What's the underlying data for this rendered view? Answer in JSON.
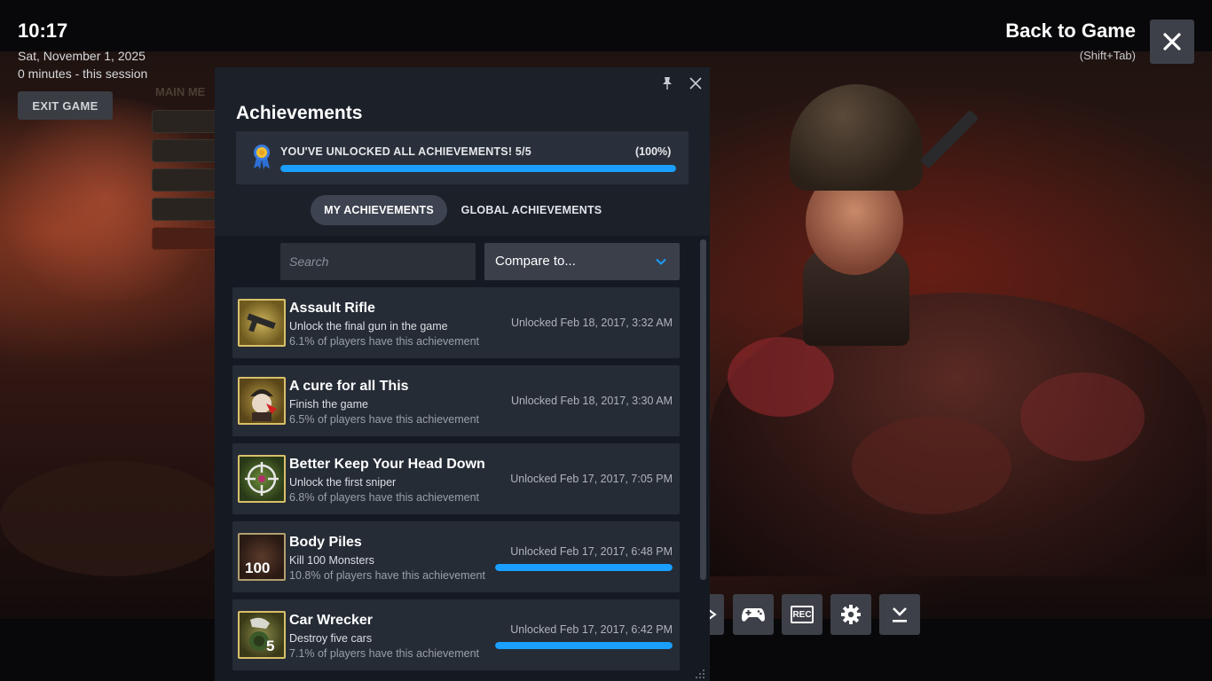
{
  "overlay": {
    "time": "10:17",
    "date": "Sat, November 1, 2025",
    "session": "0 minutes - this session",
    "exit_label": "EXIT GAME",
    "back_label": "Back to Game",
    "back_hotkey": "(Shift+Tab)",
    "close_icon": "close-icon"
  },
  "game_menu": {
    "title": "MAIN ME"
  },
  "toolbar": {
    "icons": [
      "controller-icon",
      "record-icon",
      "gear-icon",
      "download-icon"
    ],
    "rec_label": "REC"
  },
  "panel": {
    "title": "Achievements",
    "summary_text": "YOU'VE UNLOCKED ALL ACHIEVEMENTS! 5/5",
    "summary_pct": "(100%)",
    "summary_progress": 1.0,
    "tabs": [
      "MY ACHIEVEMENTS",
      "GLOBAL ACHIEVEMENTS"
    ],
    "active_tab": "MY ACHIEVEMENTS",
    "search_placeholder": "Search",
    "compare_label": "Compare to...",
    "accent_color": "#1a9fff"
  },
  "achievements": [
    {
      "name": "Assault Rifle",
      "desc": "Unlock the final gun in the game",
      "pct": "6.1% of players have this achievement",
      "unlocked": "Unlocked Feb 18, 2017, 3:32 AM",
      "icon": "rifle-icon",
      "has_bar": false
    },
    {
      "name": "A cure for all This",
      "desc": "Finish the game",
      "pct": "6.5% of players have this achievement",
      "unlocked": "Unlocked Feb 18, 2017, 3:30 AM",
      "icon": "soldier-icon",
      "has_bar": false
    },
    {
      "name": "Better Keep Your Head Down",
      "desc": "Unlock the first sniper",
      "pct": "6.8% of players have this achievement",
      "unlocked": "Unlocked Feb 17, 2017, 7:05 PM",
      "icon": "crosshair-icon",
      "has_bar": false
    },
    {
      "name": "Body Piles",
      "desc": "Kill 100 Monsters",
      "pct": "10.8% of players have this achievement",
      "unlocked": "Unlocked Feb 17, 2017, 6:48 PM",
      "icon": "monster-pile-icon",
      "icon_text": "100",
      "has_bar": true,
      "progress": 1.0
    },
    {
      "name": "Car Wrecker",
      "desc": "Destroy five cars",
      "pct": "7.1% of players have this achievement",
      "unlocked": "Unlocked Feb 17, 2017, 6:42 PM",
      "icon": "car-wreck-icon",
      "icon_text": "5",
      "has_bar": true,
      "progress": 1.0
    }
  ]
}
